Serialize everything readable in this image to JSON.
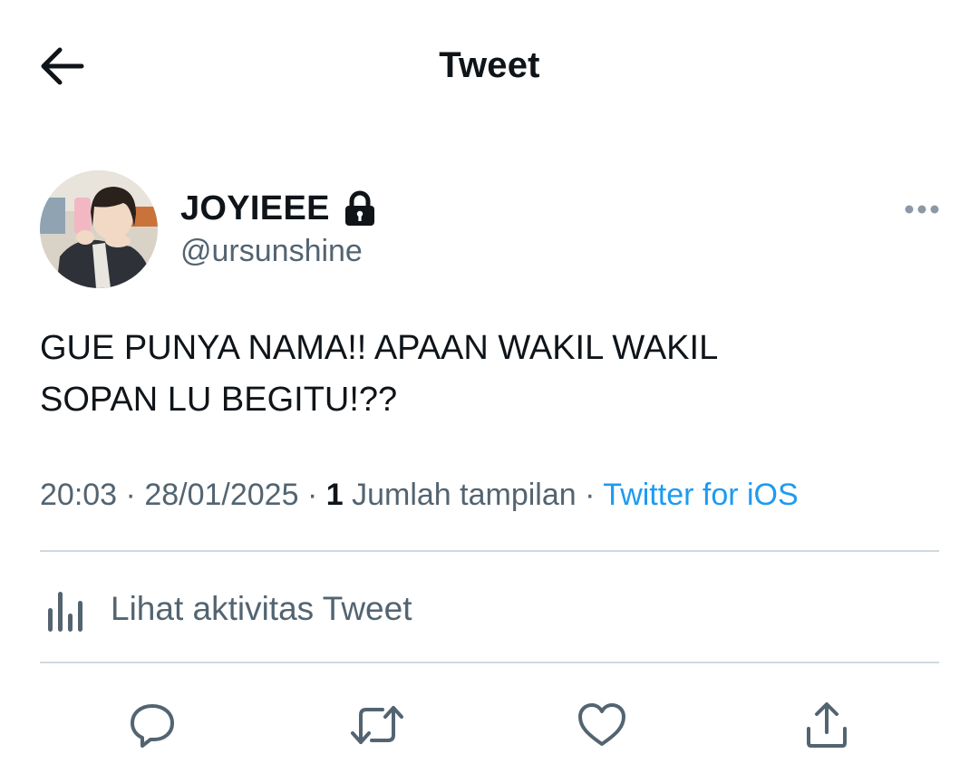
{
  "header": {
    "back_icon": "arrow-left-icon",
    "title": "Tweet"
  },
  "tweet": {
    "author": {
      "display_name": "JOYIEEE",
      "protected_icon": "lock-icon",
      "handle": "@ursunshine",
      "avatar_icon": "profile-photo"
    },
    "more_icon": "more-horizontal-icon",
    "text_line_1": "GUE PUNYA NAMA!! APAAN WAKIL WAKIL",
    "text_line_2": "SOPAN LU BEGITU!??",
    "time": "20:03",
    "separator": "·",
    "date": "28/01/2025",
    "views_count": "1",
    "views_label": "Jumlah tampilan",
    "source": "Twitter for iOS"
  },
  "activity": {
    "icon": "analytics-icon",
    "label": "Lihat aktivitas Tweet"
  },
  "actions": [
    {
      "icon": "reply-icon"
    },
    {
      "icon": "retweet-icon"
    },
    {
      "icon": "like-icon"
    },
    {
      "icon": "share-icon"
    }
  ],
  "colors": {
    "text_primary": "#0f1419",
    "text_secondary": "#536471",
    "link": "#1d9bf0",
    "divider": "#cfd9de"
  }
}
